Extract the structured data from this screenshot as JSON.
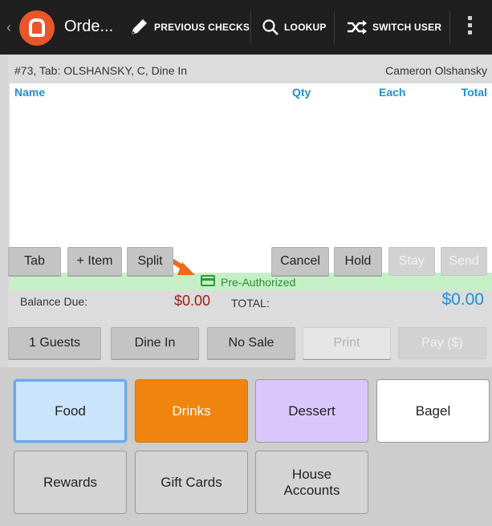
{
  "topbar": {
    "title": "Orde...",
    "previous_checks": "PREVIOUS CHECKS",
    "lookup": "LOOKUP",
    "switch_user": "SWITCH USER"
  },
  "check": {
    "header_left": "#73, Tab: OLSHANSKY, C, Dine In",
    "header_right": "Cameron Olshansky",
    "columns": {
      "name": "Name",
      "qty": "Qty",
      "each": "Each",
      "total": "Total"
    },
    "preauth_label": "Pre-Authorized"
  },
  "actions": {
    "tab": "Tab",
    "add_item": "+ Item",
    "split": "Split",
    "cancel": "Cancel",
    "hold": "Hold",
    "stay": "Stay",
    "send": "Send"
  },
  "totals": {
    "balance_label": "Balance Due:",
    "balance_value": "$0.00",
    "total_label": "TOTAL:",
    "total_value": "$0.00"
  },
  "bottom_actions": {
    "guests": "1 Guests",
    "dine_in": "Dine In",
    "no_sale": "No Sale",
    "print": "Print",
    "pay": "Pay ($)"
  },
  "categories": {
    "food": "Food",
    "drinks": "Drinks",
    "dessert": "Dessert",
    "bagel": "Bagel",
    "rewards": "Rewards",
    "gift_cards": "Gift Cards",
    "house_accounts": "House Accounts"
  },
  "colors": {
    "accent_blue": "#1e8fd4",
    "balance_red": "#9e1b1b",
    "preauth_green": "#2e8b32",
    "drinks_orange": "#ef850f",
    "brand_orange": "#e8562a"
  }
}
